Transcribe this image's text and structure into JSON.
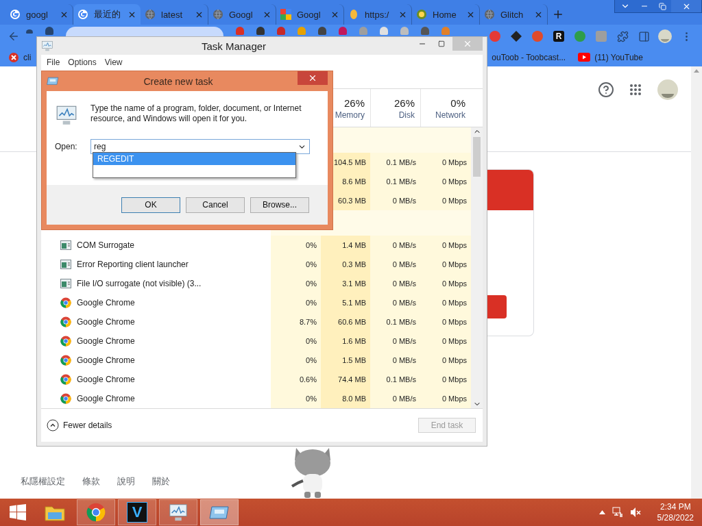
{
  "browser": {
    "tabs": [
      {
        "label": "googl",
        "kind": "google",
        "selected": false
      },
      {
        "label": "最近的",
        "kind": "google",
        "selected": true
      },
      {
        "label": "latest",
        "kind": "globe",
        "selected": false
      },
      {
        "label": "Googl",
        "kind": "globe",
        "selected": false
      },
      {
        "label": "Googl",
        "kind": "tiles",
        "selected": false
      },
      {
        "label": "https:/",
        "kind": "coin",
        "selected": false
      },
      {
        "label": "Home",
        "kind": "badge",
        "selected": false
      },
      {
        "label": "Glitch",
        "kind": "globe",
        "selected": false
      }
    ],
    "extension_letter": "R",
    "bookmarks": [
      {
        "label": "cli",
        "kind": "error"
      },
      {
        "label": "ouToob - Toobcast...",
        "kind": "plain"
      },
      {
        "label": "(11) YouTube",
        "kind": "youtube"
      }
    ],
    "footer_links": [
      "私隱權設定",
      "條款",
      "說明",
      "關於"
    ]
  },
  "task_manager": {
    "title": "Task Manager",
    "menu": [
      "File",
      "Options",
      "View"
    ],
    "columns": [
      {
        "percent": "26%",
        "label": "Memory"
      },
      {
        "percent": "26%",
        "label": "Disk"
      },
      {
        "percent": "0%",
        "label": "Network"
      }
    ],
    "rows": [
      {
        "kind": "group"
      },
      {
        "kind": "process",
        "memory": "104.5 MB",
        "disk": "0.1 MB/s",
        "network": "0 Mbps"
      },
      {
        "kind": "process",
        "memory": "8.6 MB",
        "disk": "0.1 MB/s",
        "network": "0 Mbps"
      },
      {
        "kind": "process",
        "memory": "60.3 MB",
        "disk": "0 MB/s",
        "network": "0 Mbps"
      },
      {
        "kind": "group"
      },
      {
        "kind": "window",
        "name": "COM Surrogate",
        "cpu": "0%",
        "memory": "1.4 MB",
        "disk": "0 MB/s",
        "network": "0 Mbps"
      },
      {
        "kind": "window",
        "name": "Error Reporting client launcher",
        "cpu": "0%",
        "memory": "0.3 MB",
        "disk": "0 MB/s",
        "network": "0 Mbps"
      },
      {
        "kind": "window",
        "name": "File I/O surrogate (not visible) (3...",
        "cpu": "0%",
        "memory": "3.1 MB",
        "disk": "0 MB/s",
        "network": "0 Mbps"
      },
      {
        "kind": "chrome",
        "name": "Google Chrome",
        "cpu": "0%",
        "memory": "5.1 MB",
        "disk": "0 MB/s",
        "network": "0 Mbps"
      },
      {
        "kind": "chrome",
        "name": "Google Chrome",
        "cpu": "8.7%",
        "memory": "60.6 MB",
        "disk": "0.1 MB/s",
        "network": "0 Mbps"
      },
      {
        "kind": "chrome",
        "name": "Google Chrome",
        "cpu": "0%",
        "memory": "1.6 MB",
        "disk": "0 MB/s",
        "network": "0 Mbps"
      },
      {
        "kind": "chrome",
        "name": "Google Chrome",
        "cpu": "0%",
        "memory": "1.5 MB",
        "disk": "0 MB/s",
        "network": "0 Mbps"
      },
      {
        "kind": "chrome",
        "name": "Google Chrome",
        "cpu": "0.6%",
        "memory": "74.4 MB",
        "disk": "0.1 MB/s",
        "network": "0 Mbps"
      },
      {
        "kind": "chrome",
        "name": "Google Chrome",
        "cpu": "0%",
        "memory": "8.0 MB",
        "disk": "0 MB/s",
        "network": "0 Mbps"
      }
    ],
    "fewer_details": "Fewer details",
    "end_task": {
      "label": "End task",
      "disabled": true
    }
  },
  "run_dialog": {
    "title": "Create new task",
    "message": "Type the name of a program, folder, document, or Internet resource, and Windows will open it for you.",
    "open_label": "Open:",
    "value": "reg",
    "suggestions": [
      {
        "label": "REGEDIT",
        "selected": true
      }
    ],
    "buttons": [
      {
        "label": "OK",
        "default": true
      },
      {
        "label": "Cancel",
        "default": false
      },
      {
        "label": "Browse...",
        "default": false
      }
    ]
  },
  "taskbar": {
    "apps": [
      {
        "kind": "explorer",
        "running": false,
        "selected": false
      },
      {
        "kind": "chrome",
        "running": true,
        "selected": false
      },
      {
        "kind": "letter",
        "letter": "V",
        "running": true,
        "selected": false
      },
      {
        "kind": "monitor",
        "running": true,
        "selected": false
      },
      {
        "kind": "run",
        "running": true,
        "selected": true
      }
    ],
    "time": "2:34 PM",
    "date": "5/28/2022"
  }
}
